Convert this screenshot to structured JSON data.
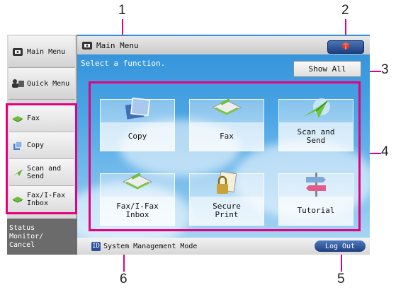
{
  "callouts": [
    "1",
    "2",
    "3",
    "4",
    "5",
    "6"
  ],
  "sidebar": {
    "main_menu": "Main Menu",
    "quick_menu": "Quick Menu",
    "favorites": [
      {
        "label": "Fax",
        "icon": "fax-icon"
      },
      {
        "label": "Copy",
        "icon": "copy-icon"
      },
      {
        "label": "Scan and Send",
        "icon": "scan-send-icon"
      },
      {
        "label": "Fax/I-Fax Inbox",
        "icon": "fax-inbox-icon"
      }
    ],
    "status_monitor": "Status Monitor/ Cancel"
  },
  "header": {
    "title": "Main Menu",
    "instruction": "Select a function.",
    "show_all": "Show All"
  },
  "functions": [
    {
      "label": "Copy",
      "icon": "copy-icon"
    },
    {
      "label": "Fax",
      "icon": "fax-icon"
    },
    {
      "label": "Scan and Send",
      "icon": "scan-send-icon"
    },
    {
      "label": "Fax/I-Fax Inbox",
      "icon": "fax-inbox-icon"
    },
    {
      "label": "Secure Print",
      "icon": "secure-print-icon"
    },
    {
      "label": "Tutorial",
      "icon": "tutorial-icon"
    }
  ],
  "status_bar": {
    "mode_badge": "ID",
    "mode_text": "System Management Mode",
    "logout": "Log Out"
  },
  "colors": {
    "callout_accent": "#e4007f",
    "sky_top": "#2f8fd8",
    "button_blue": "#1f3f80"
  }
}
